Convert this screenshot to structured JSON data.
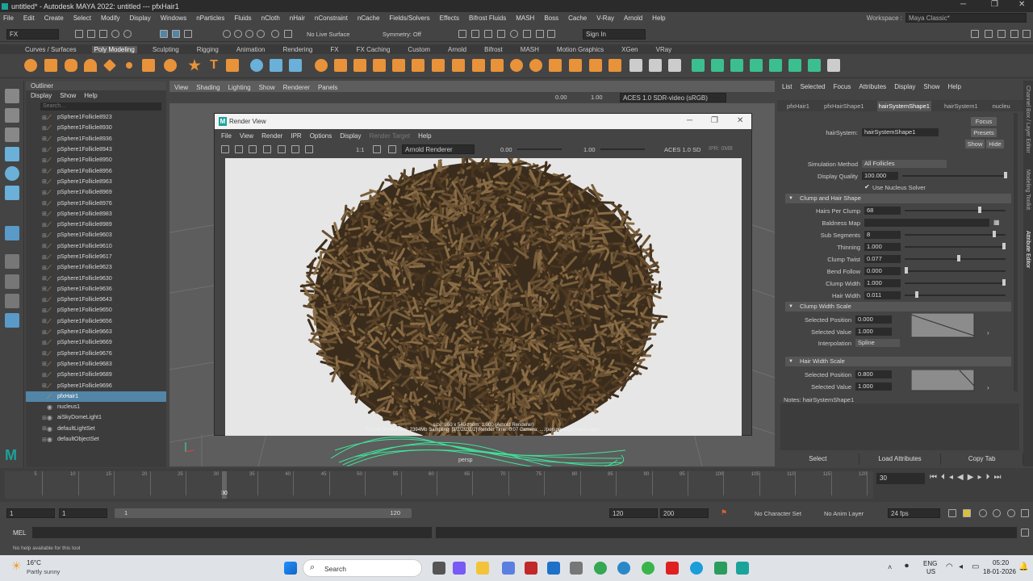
{
  "window": {
    "title": "untitled* - Autodesk MAYA 2022: untitled   ---   pfxHair1",
    "minimize": "─",
    "maximize": "❐",
    "close": "✕"
  },
  "menubar": [
    "File",
    "Edit",
    "Create",
    "Select",
    "Modify",
    "Display",
    "Windows",
    "nParticles",
    "Fluids",
    "nCloth",
    "nHair",
    "nConstraint",
    "nCache",
    "Fields/Solvers",
    "Effects",
    "Bifrost Fluids",
    "MASH",
    "Boss",
    "Cache",
    "V-Ray",
    "Arnold",
    "Help"
  ],
  "workspace": {
    "label": "Workspace :",
    "value": "Maya Classic*"
  },
  "statusline": {
    "menuset": "FX",
    "live_surface": "No Live Surface",
    "symmetry": "Symmetry: Off",
    "sign_in": "Sign In"
  },
  "shelf_tabs": [
    "Curves / Surfaces",
    "Poly Modeling",
    "Sculpting",
    "Rigging",
    "Animation",
    "Rendering",
    "FX",
    "FX Caching",
    "Custom",
    "Arnold",
    "Bifrost",
    "MASH",
    "Motion Graphics",
    "XGen",
    "VRay"
  ],
  "shelf_active": "Poly Modeling",
  "outliner": {
    "title": "Outliner",
    "menu": [
      "Display",
      "Show",
      "Help"
    ],
    "search_placeholder": "Search...",
    "rows": [
      {
        "label": "pSphere1Follicle8923",
        "type": "follicle"
      },
      {
        "label": "pSphere1Follicle8930",
        "type": "follicle"
      },
      {
        "label": "pSphere1Follicle8936",
        "type": "follicle"
      },
      {
        "label": "pSphere1Follicle8943",
        "type": "follicle"
      },
      {
        "label": "pSphere1Follicle8950",
        "type": "follicle"
      },
      {
        "label": "pSphere1Follicle8956",
        "type": "follicle"
      },
      {
        "label": "pSphere1Follicle8963",
        "type": "follicle"
      },
      {
        "label": "pSphere1Follicle8969",
        "type": "follicle"
      },
      {
        "label": "pSphere1Follicle8976",
        "type": "follicle"
      },
      {
        "label": "pSphere1Follicle8983",
        "type": "follicle"
      },
      {
        "label": "pSphere1Follicle8989",
        "type": "follicle"
      },
      {
        "label": "pSphere1Follicle9603",
        "type": "follicle"
      },
      {
        "label": "pSphere1Follicle9610",
        "type": "follicle"
      },
      {
        "label": "pSphere1Follicle9617",
        "type": "follicle"
      },
      {
        "label": "pSphere1Follicle9623",
        "type": "follicle"
      },
      {
        "label": "pSphere1Follicle9630",
        "type": "follicle"
      },
      {
        "label": "pSphere1Follicle9636",
        "type": "follicle"
      },
      {
        "label": "pSphere1Follicle9643",
        "type": "follicle"
      },
      {
        "label": "pSphere1Follicle9650",
        "type": "follicle"
      },
      {
        "label": "pSphere1Follicle9656",
        "type": "follicle"
      },
      {
        "label": "pSphere1Follicle9663",
        "type": "follicle"
      },
      {
        "label": "pSphere1Follicle9669",
        "type": "follicle"
      },
      {
        "label": "pSphere1Follicle9676",
        "type": "follicle"
      },
      {
        "label": "pSphere1Follicle9683",
        "type": "follicle"
      },
      {
        "label": "pSphere1Follicle9689",
        "type": "follicle"
      },
      {
        "label": "pSphere1Follicle9696",
        "type": "follicle"
      },
      {
        "label": "pfxHair1",
        "type": "selected"
      },
      {
        "label": "nucleus1",
        "type": "node"
      },
      {
        "label": "aiSkyDomeLight1",
        "type": "light"
      },
      {
        "label": "defaultLightSet",
        "type": "set"
      },
      {
        "label": "defaultObjectSet",
        "type": "set"
      }
    ]
  },
  "viewport": {
    "menu": [
      "View",
      "Shading",
      "Lighting",
      "Show",
      "Renderer",
      "Panels"
    ],
    "exposure": "0.00",
    "gamma": "1.00",
    "colorspace": "ACES 1.0 SDR-video (sRGB)",
    "camera_label": "persp"
  },
  "render_view": {
    "title": "Render View",
    "menu": [
      "File",
      "View",
      "Render",
      "IPR",
      "Options",
      "Display",
      "Render Target",
      "Help"
    ],
    "renderer": "Arnold Renderer",
    "ratio": "1:1",
    "exposure": "0.00",
    "gamma": "1.00",
    "colorspace": "ACES 1.0 SD",
    "ipr": "IPR: 0MB",
    "info_line1": "size: 960 x 540  zoom: 1.000    (Arnold Renderer)",
    "info_line2": "Frame: 30    Memory: 2394Mb    Sampling: [3/2/2/2/2/2]    Render Time: 0:07    Camera: ...:/persp/perspShape    Layer:"
  },
  "attribute_editor": {
    "menu": [
      "List",
      "Selected",
      "Focus",
      "Attributes",
      "Display",
      "Show",
      "Help"
    ],
    "tabs": [
      "pfxHair1",
      "pfxHairShape1",
      "hairSystemShape1",
      "hairSystem1",
      "nucleu"
    ],
    "active_tab": "hairSystemShape1",
    "node_label": "hairSystem:",
    "node_value": "hairSystemShape1",
    "focus": "Focus",
    "presets": "Presets",
    "show": "Show",
    "hide": "Hide",
    "sim_method_label": "Simulation Method",
    "sim_method_value": "All Follicles",
    "display_quality_label": "Display Quality",
    "display_quality_value": "100.000",
    "use_nucleus": "Use Nucleus Solver",
    "section_clump": "Clump and Hair Shape",
    "attrs": [
      {
        "label": "Hairs Per Clump",
        "value": "68",
        "level": 0.75
      },
      {
        "label": "Baldness Map",
        "value": "",
        "level": null
      },
      {
        "label": "Sub Segments",
        "value": "8",
        "level": 0.9
      },
      {
        "label": "Thinning",
        "value": "1.000",
        "level": 1.0
      },
      {
        "label": "Clump Twist",
        "value": "0.077",
        "level": 0.54
      },
      {
        "label": "Bend Follow",
        "value": "0.000",
        "level": 0.0
      },
      {
        "label": "Clump Width",
        "value": "1.000",
        "level": 1.0
      },
      {
        "label": "Hair Width",
        "value": "0.011",
        "level": 0.11
      }
    ],
    "section_clump_width": "Clump Width Scale",
    "sel_pos_label": "Selected Position",
    "sel_pos_value": "0.000",
    "sel_val_label": "Selected Value",
    "sel_val_value": "1.000",
    "interp_label": "Interpolation",
    "interp_value": "Spline",
    "section_hair_width": "Hair Width Scale",
    "hw_sel_pos_value": "0.800",
    "hw_sel_val_value": "1.000",
    "notes": "Notes:  hairSystemShape1",
    "buttons": [
      "Select",
      "Load Attributes",
      "Copy Tab"
    ]
  },
  "side_tabs": [
    "Channel Box / Layer Editor",
    "Modeling Toolkit",
    "Attribute Editor"
  ],
  "timeline": {
    "ticks": [
      "5",
      "10",
      "15",
      "20",
      "25",
      "30",
      "35",
      "40",
      "45",
      "50",
      "55",
      "60",
      "65",
      "70",
      "75",
      "80",
      "85",
      "90",
      "95",
      "100",
      "105",
      "110",
      "115",
      "120"
    ],
    "current_frame": "30",
    "current_frame_field": "30"
  },
  "range": {
    "start": "1",
    "start2": "1",
    "range_start": "1",
    "range_end": "120",
    "end": "120",
    "end2": "200",
    "character": "No Character Set",
    "anim_layer": "No Anim Layer",
    "fps": "24 fps"
  },
  "cmdline": {
    "label": "MEL"
  },
  "helpline": "No help available for this tool",
  "taskbar": {
    "temp": "16°C",
    "weather": "Partly sunny",
    "search": "Search",
    "lang1": "ENG",
    "lang2": "US",
    "time": "05:20",
    "date": "18-01-2026"
  }
}
